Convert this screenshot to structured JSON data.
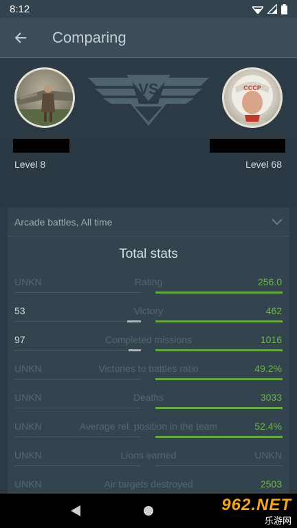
{
  "status": {
    "time": "8:12"
  },
  "appbar": {
    "title": "Comparing"
  },
  "players": {
    "left": {
      "level": "Level 8"
    },
    "right": {
      "level": "Level 68"
    },
    "vs": "VS"
  },
  "filter": {
    "label": "Arcade battles, All time"
  },
  "section": {
    "title": "Total stats"
  },
  "stats": [
    {
      "name": "Rating",
      "left": "UNKN",
      "right": "256.0",
      "left_fill": 0,
      "right_fill": 1
    },
    {
      "name": "Victory",
      "left": "53",
      "right": "462",
      "left_fill": 0.11,
      "right_fill": 1
    },
    {
      "name": "Completed missions",
      "left": "97",
      "right": "1016",
      "left_fill": 0.1,
      "right_fill": 1
    },
    {
      "name": "Victories to battles ratio",
      "left": "UNKN",
      "right": "49.2%",
      "left_fill": 0,
      "right_fill": 1
    },
    {
      "name": "Deaths",
      "left": "UNKN",
      "right": "3033",
      "left_fill": 0,
      "right_fill": 1
    },
    {
      "name": "Average rel. position in the team",
      "left": "UNKN",
      "right": "52.4%",
      "left_fill": 0,
      "right_fill": 1
    },
    {
      "name": "Lions earned",
      "left": "UNKN",
      "right": "UNKN",
      "left_fill": 0,
      "right_fill": 0
    },
    {
      "name": "Air targets destroyed",
      "left": "UNKN",
      "right": "2503",
      "left_fill": 0,
      "right_fill": 1
    }
  ],
  "watermark": {
    "line1": "962.NET",
    "line2": "乐游网"
  },
  "colors": {
    "accent_green": "#65a843",
    "background": "#2b3a44",
    "card": "#34444f"
  }
}
